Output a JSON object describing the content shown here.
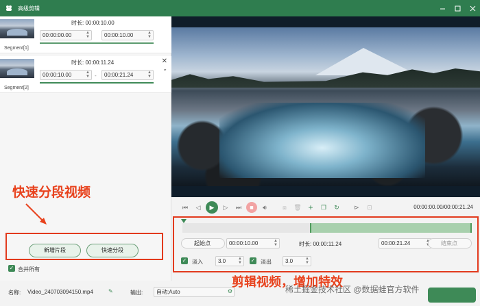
{
  "window": {
    "title": "高级剪辑"
  },
  "segments": [
    {
      "label": "Segment[1]",
      "duration_label": "时长:",
      "duration": "00:00:10.00",
      "start": "00:00:00.00",
      "end": "00:00:10.00"
    },
    {
      "label": "Segment[2]",
      "duration_label": "时长:",
      "duration": "00:00:11.24",
      "start": "00:00:10.00",
      "end": "00:00:21.24",
      "dash": "-"
    }
  ],
  "left_panel": {
    "annotation": "快速分段视频",
    "new_segment_button": "新增片段",
    "quick_split_button": "快速分段",
    "merge_all_label": "合并所有"
  },
  "player": {
    "time_readout": "00:00:00.00/00:00:21.24"
  },
  "editor": {
    "start_point_button": "起始点",
    "start_time": "00:00:10.00",
    "duration_label": "时长:",
    "duration_value": "00:00:11.24",
    "end_time": "00:00:21.24",
    "end_point_button": "结束点",
    "fade_in_label": "淡入",
    "fade_in_value": "3.0",
    "fade_out_label": "淡出",
    "fade_out_value": "3.0",
    "annotation": "剪辑视频，增加特效"
  },
  "bottom": {
    "name_label": "名称:",
    "file_name": "Video_240703094150.mp4",
    "output_label": "输出:",
    "output_value": "自动;Auto"
  },
  "watermark": "稀土掘金技术社区 @数据蛙官方软件",
  "colors": {
    "titlebar": "#2f7d4f",
    "accent_green": "#3e8a57",
    "annotation_red": "#e23a1d"
  }
}
